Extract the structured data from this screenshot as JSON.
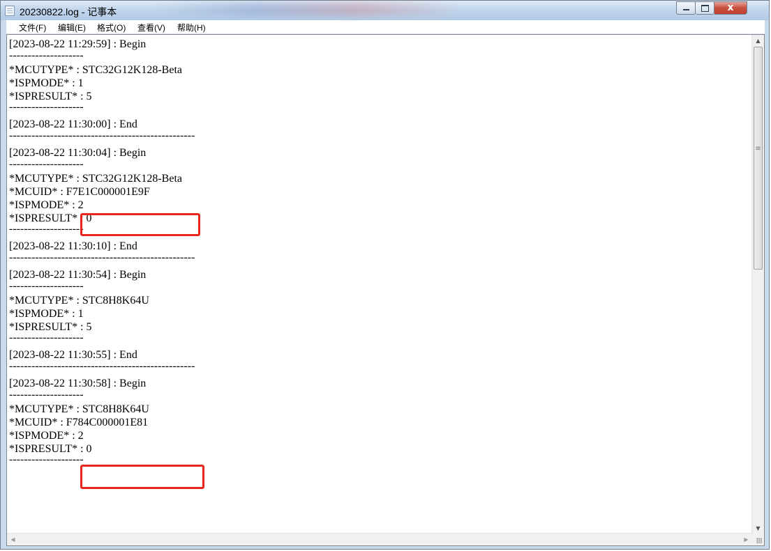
{
  "window": {
    "title": "20230822.log - 记事本",
    "close_label": "x"
  },
  "menu": [
    {
      "label": "文件(F)"
    },
    {
      "label": "编辑(E)"
    },
    {
      "label": "格式(O)"
    },
    {
      "label": "查看(V)"
    },
    {
      "label": "帮助(H)"
    }
  ],
  "log_lines": [
    "[2023-08-22 11:29:59] : Begin",
    "--------------------",
    "*MCUTYPE* : STC32G12K128-Beta",
    "*ISPMODE* : 1",
    "*ISPRESULT* : 5",
    "--------------------",
    "[2023-08-22 11:30:00] : End",
    "--------------------------------------------------",
    "[2023-08-22 11:30:04] : Begin",
    "--------------------",
    "*MCUTYPE* : STC32G12K128-Beta",
    "*MCUID* : F7E1C000001E9F",
    "*ISPMODE* : 2",
    "*ISPRESULT* : 0",
    "--------------------",
    "[2023-08-22 11:30:10] : End",
    "--------------------------------------------------",
    "[2023-08-22 11:30:54] : Begin",
    "--------------------",
    "*MCUTYPE* : STC8H8K64U",
    "*ISPMODE* : 1",
    "*ISPRESULT* : 5",
    "--------------------",
    "[2023-08-22 11:30:55] : End",
    "--------------------------------------------------",
    "[2023-08-22 11:30:58] : Begin",
    "--------------------",
    "*MCUTYPE* : STC8H8K64U",
    "*MCUID* : F784C000001E81",
    "*ISPMODE* : 2",
    "*ISPRESULT* : 0",
    "--------------------"
  ],
  "highlight_color": "#e8261d"
}
